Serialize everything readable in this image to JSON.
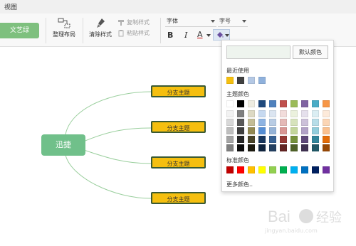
{
  "menubar": {
    "view_label": "视图"
  },
  "toolbar": {
    "theme_label": "文艺绿",
    "layout_label": "整理布局",
    "clear_style_label": "清除样式",
    "copy_style_label": "复制样式",
    "paste_style_label": "粘贴样式",
    "font_placeholder": "字体",
    "size_placeholder": "字号",
    "bold_label": "B",
    "italic_label": "I",
    "font_color_label": "A"
  },
  "mindmap": {
    "root_label": "迅捷",
    "branches": [
      "分支主题",
      "分支主题",
      "分支主题",
      "分支主题"
    ]
  },
  "palette": {
    "default_label": "默认颜色",
    "recent_label": "最近使用",
    "recent_colors": [
      "#f5bf0f",
      "#404040",
      "#b4c8e4",
      "#8fb1dc"
    ],
    "theme_label": "主题颜色",
    "theme_columns": [
      [
        "#ffffff",
        "#f2f2f2",
        "#d8d8d8",
        "#bfbfbf",
        "#a5a5a5",
        "#7f7f7f"
      ],
      [
        "#000000",
        "#7f7f7f",
        "#595959",
        "#3f3f3f",
        "#262626",
        "#0c0c0c"
      ],
      [
        "#eeece1",
        "#ddd9c3",
        "#c4bd97",
        "#938953",
        "#494429",
        "#1d1b10"
      ],
      [
        "#1f497d",
        "#c6d9f0",
        "#8db3e2",
        "#548dd4",
        "#17365d",
        "#0f243e"
      ],
      [
        "#4f81bd",
        "#dbe5f1",
        "#b8cce4",
        "#95b3d7",
        "#366092",
        "#244061"
      ],
      [
        "#c0504d",
        "#f2dcdb",
        "#e5b9b7",
        "#d99694",
        "#953734",
        "#632423"
      ],
      [
        "#9bbb59",
        "#ebf1dd",
        "#d7e3bc",
        "#c3d69b",
        "#76923c",
        "#4f6128"
      ],
      [
        "#8064a2",
        "#e5e0ec",
        "#ccc1d9",
        "#b2a2c7",
        "#5f497a",
        "#3f3151"
      ],
      [
        "#4bacc6",
        "#dbeef3",
        "#b7dde8",
        "#92cddc",
        "#31859b",
        "#205867"
      ],
      [
        "#f79646",
        "#fdeada",
        "#fbd5b5",
        "#fac08f",
        "#e36c09",
        "#974806"
      ]
    ],
    "standard_label": "标准颜色",
    "standard_colors": [
      "#c00000",
      "#ff0000",
      "#ffc000",
      "#ffff00",
      "#92d050",
      "#00b050",
      "#00b0f0",
      "#0070c0",
      "#002060",
      "#7030a0"
    ],
    "more_label": "更多颜色.."
  },
  "watermark": {
    "text": "jingyan.baidu.com"
  }
}
